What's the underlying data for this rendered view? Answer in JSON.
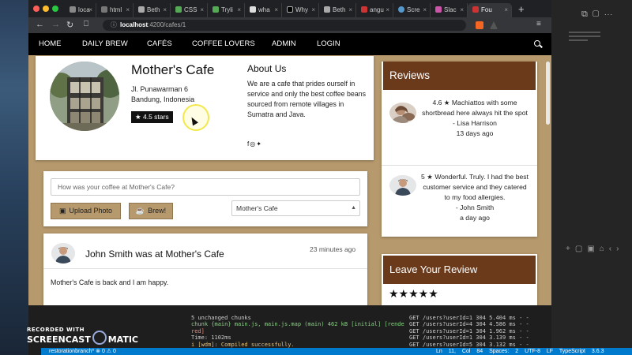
{
  "browser": {
    "tabs": [
      {
        "label": "loca",
        "active": false
      },
      {
        "label": "html",
        "active": false
      },
      {
        "label": "Beth",
        "active": false
      },
      {
        "label": "CSS",
        "active": false
      },
      {
        "label": "Tryli",
        "active": false
      },
      {
        "label": "wha",
        "active": false
      },
      {
        "label": "Why",
        "active": false
      },
      {
        "label": "Beth",
        "active": false
      },
      {
        "label": "angu",
        "active": false
      },
      {
        "label": "Scre",
        "active": false
      },
      {
        "label": "Slac",
        "active": false
      },
      {
        "label": "Fou",
        "active": true
      }
    ],
    "url_host": "localhost",
    "url_path": ":4200/cafes/1"
  },
  "nav": {
    "home": "HOME",
    "daily_brew": "DAILY BREW",
    "cafes": "CAFÉS",
    "coffee_lovers": "COFFEE LOVERS",
    "admin": "ADMIN",
    "login": "LOGIN"
  },
  "cafe": {
    "name": "Mother's Cafe",
    "address_line1": "Jl. Punawarman 6",
    "address_line2": "Bandung, Indonesia",
    "rating": "★ 4.5 stars",
    "about_title": "About Us",
    "about_text": "We are a cafe that prides ourself in service and only the best coffee beans sourced from remote villages in Sumatra and Java.",
    "social_icons": [
      "facebook-icon",
      "instagram-icon",
      "twitter-icon"
    ]
  },
  "post": {
    "placeholder": "How was your coffee at Mother's Cafe?",
    "upload_label": "Upload Photo",
    "brew_label": "Brew!",
    "selected_cafe": "Mother's Cafe"
  },
  "checkin": {
    "title": "John Smith was at Mother's Cafe",
    "time": "23 minutes ago",
    "body": "Mother's Cafe is back and I am happy."
  },
  "reviews": {
    "heading": "Reviews",
    "items": [
      {
        "rating": "4.6 ★",
        "text": "Machiattos with some shortbread here always hit the spot",
        "author": "- Lisa Harrison",
        "time": "13 days ago"
      },
      {
        "rating": "5 ★",
        "text": "Wonderful. Truly. I had the best customer service and they catered to my food allergies.",
        "author": "- John Smith",
        "time": "a day ago"
      }
    ]
  },
  "leave_review": {
    "heading": "Leave Your Review",
    "stars": "★★★★★"
  },
  "terminal": {
    "left": [
      "5 unchanged chunks",
      "chunk {main} main.js, main.js.map (main) 462 kB [initial] [rende",
      "red]",
      "Time: 1102ms",
      "i [wdm]: Compiled successfully."
    ],
    "right": [
      "GET /users?userId=1 304 5.404 ms - -",
      "GET /users?userId=4 304 4.586 ms - -",
      "GET /users?userId=1 304 1.962 ms - -",
      "GET /users?userId=1 304 3.139 ms - -",
      "GET /users?userId=5 304 3.132 ms - -"
    ]
  },
  "statusbar": {
    "left": "restorationbranch*  ⊗ 0 ⚠ 0",
    "right": "Ln 11, Col 84  Spaces: 2  UTF-8  LF  TypeScript  3.6.3"
  },
  "watermark": {
    "line1": "RECORDED WITH",
    "line2a": "SCREENCAST",
    "line2b": "MATIC"
  }
}
